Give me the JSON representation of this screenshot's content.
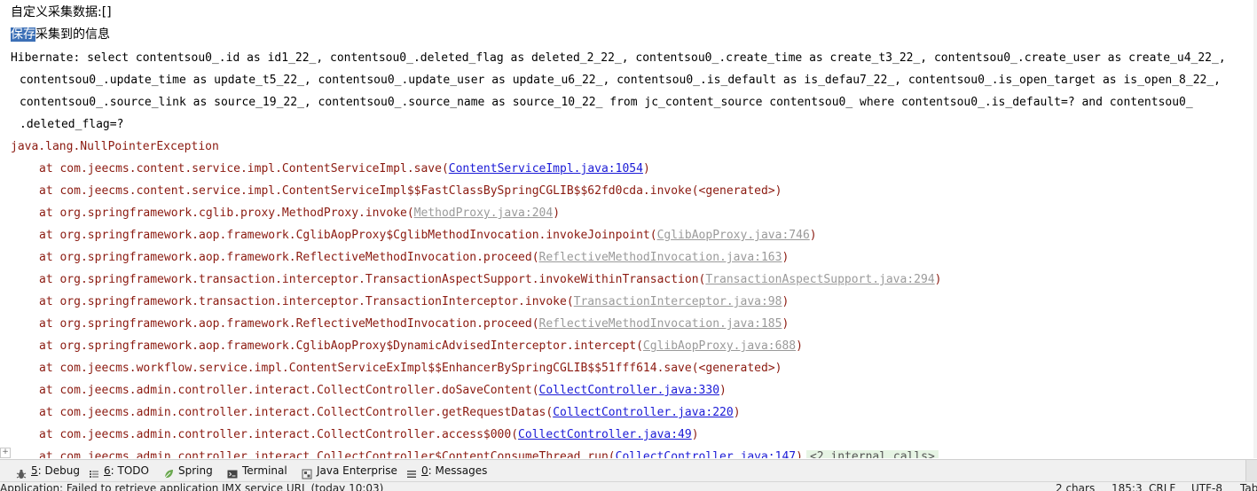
{
  "console": {
    "line1": "自定义采集数据:[]",
    "line2_selected": "保存",
    "line2_rest": "采集到的信息",
    "hibernate": [
      "Hibernate: select contentsou0_.id as id1_22_, contentsou0_.deleted_flag as deleted_2_22_, contentsou0_.create_time as create_t3_22_, contentsou0_.create_user as create_u4_22_,",
      "contentsou0_.update_time as update_t5_22_, contentsou0_.update_user as update_u6_22_, contentsou0_.is_default as is_defau7_22_, contentsou0_.is_open_target as is_open_8_22_,",
      "contentsou0_.source_link as source_19_22_, contentsou0_.source_name as source_10_22_ from jc_content_source contentsou0_ where contentsou0_.is_default=? and contentsou0_",
      ".deleted_flag=?"
    ],
    "exception": "java.lang.NullPointerException",
    "frames": [
      {
        "method": "at com.jeecms.content.service.impl.ContentServiceImpl.save(",
        "link": "ContentServiceImpl.java:1054",
        "lib": false,
        "suffix": ")"
      },
      {
        "method": "at com.jeecms.content.service.impl.ContentServiceImpl$$FastClassBySpringCGLIB$$62fd0cda.invoke(",
        "link": "",
        "generated": "<generated>",
        "suffix": ")"
      },
      {
        "method": "at org.springframework.cglib.proxy.MethodProxy.invoke(",
        "link": "MethodProxy.java:204",
        "lib": true,
        "suffix": ")"
      },
      {
        "method": "at org.springframework.aop.framework.CglibAopProxy$CglibMethodInvocation.invokeJoinpoint(",
        "link": "CglibAopProxy.java:746",
        "lib": true,
        "suffix": ")"
      },
      {
        "method": "at org.springframework.aop.framework.ReflectiveMethodInvocation.proceed(",
        "link": "ReflectiveMethodInvocation.java:163",
        "lib": true,
        "suffix": ")"
      },
      {
        "method": "at org.springframework.transaction.interceptor.TransactionAspectSupport.invokeWithinTransaction(",
        "link": "TransactionAspectSupport.java:294",
        "lib": true,
        "suffix": ")"
      },
      {
        "method": "at org.springframework.transaction.interceptor.TransactionInterceptor.invoke(",
        "link": "TransactionInterceptor.java:98",
        "lib": true,
        "suffix": ")"
      },
      {
        "method": "at org.springframework.aop.framework.ReflectiveMethodInvocation.proceed(",
        "link": "ReflectiveMethodInvocation.java:185",
        "lib": true,
        "suffix": ")"
      },
      {
        "method": "at org.springframework.aop.framework.CglibAopProxy$DynamicAdvisedInterceptor.intercept(",
        "link": "CglibAopProxy.java:688",
        "lib": true,
        "suffix": ")"
      },
      {
        "method": "at com.jeecms.workflow.service.impl.ContentServiceExImpl$$EnhancerBySpringCGLIB$$51fff614.save(",
        "link": "",
        "generated": "<generated>",
        "suffix": ")"
      },
      {
        "method": "at com.jeecms.admin.controller.interact.CollectController.doSaveContent(",
        "link": "CollectController.java:330",
        "lib": false,
        "suffix": ")"
      },
      {
        "method": "at com.jeecms.admin.controller.interact.CollectController.getRequestDatas(",
        "link": "CollectController.java:220",
        "lib": false,
        "suffix": ")"
      },
      {
        "method": "at com.jeecms.admin.controller.interact.CollectController.access$000(",
        "link": "CollectController.java:49",
        "lib": false,
        "suffix": ")"
      },
      {
        "method": "at com.jeecms.admin.controller.interact.CollectController$ContentConsumeThread.run(",
        "link": "CollectController.java:147",
        "lib": false,
        "suffix": ")",
        "internal": "<2 internal calls>"
      }
    ]
  },
  "toolbar": {
    "items": [
      {
        "key": "5",
        "label": ": Debug",
        "icon": "bug-icon"
      },
      {
        "key": "6",
        "label": ": TODO",
        "icon": "todo-list-icon"
      },
      {
        "key": "",
        "label": "Spring",
        "icon": "spring-leaf-icon"
      },
      {
        "key": "",
        "label": "Terminal",
        "icon": "terminal-icon"
      },
      {
        "key": "",
        "label": "Java Enterprise",
        "icon": "java-enterprise-icon"
      },
      {
        "key": "0",
        "label": ": Messages",
        "icon": "messages-icon"
      }
    ]
  },
  "status": {
    "message": "Application: Failed to retrieve application JMX service URL (today 10:03)",
    "chars": "2 chars",
    "position": "185:3",
    "line_ending": "CRLF",
    "encoding": "UTF-8",
    "indent": "Tab"
  },
  "colors": {
    "selection": "#3b6fb6",
    "stack_text": "#8b1a10",
    "link": "#1a1ad6",
    "library_link": "#9a9a9a",
    "internal_calls_bg": "#e6f4e4"
  }
}
